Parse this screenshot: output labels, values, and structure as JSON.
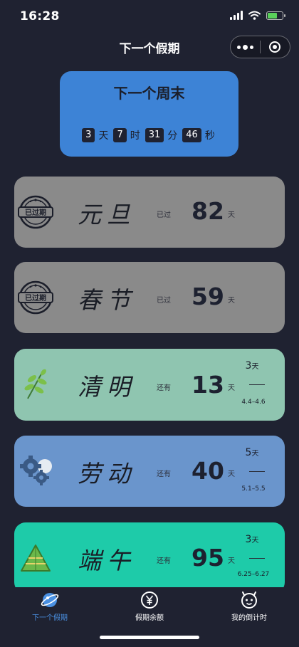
{
  "status_bar": {
    "time": "16:28",
    "icons": [
      "signal-icon",
      "wifi-icon",
      "battery-charging-icon"
    ]
  },
  "nav": {
    "title": "下一个假期",
    "icons": [
      "more-dots-icon",
      "close-target-icon"
    ]
  },
  "weekend": {
    "title": "下一个周末",
    "countdown": [
      {
        "value": "3",
        "unit": "天"
      },
      {
        "value": "7",
        "unit": "时"
      },
      {
        "value": "31",
        "unit": "分"
      },
      {
        "value": "46",
        "unit": "秒"
      }
    ]
  },
  "holidays": [
    {
      "name": "元旦",
      "status": "已过",
      "days": "82",
      "unit": "天",
      "icon": "expired-stamp-icon",
      "color": "#8a8a8a"
    },
    {
      "name": "春节",
      "status": "已过",
      "days": "59",
      "unit": "天",
      "icon": "expired-stamp-icon",
      "color": "#8a8a8a"
    },
    {
      "name": "清明",
      "status": "还有",
      "days": "13",
      "unit": "天",
      "length": "3",
      "length_unit": "天",
      "range": "4.4–4.6",
      "icon": "leaf-sprig-icon",
      "color": "#8fc5b0"
    },
    {
      "name": "劳动",
      "status": "还有",
      "days": "40",
      "unit": "天",
      "length": "5",
      "length_unit": "天",
      "range": "5.1–5.5",
      "icon": "gears-icon",
      "color": "#6a95cc"
    },
    {
      "name": "端午",
      "status": "还有",
      "days": "95",
      "unit": "天",
      "length": "3",
      "length_unit": "天",
      "range": "6.25–6.27",
      "icon": "zongzi-icon",
      "color": "#1ecba9"
    }
  ],
  "tabs": [
    {
      "label": "下一个假期",
      "icon": "planet-icon",
      "active": true
    },
    {
      "label": "假期余额",
      "icon": "yen-coin-icon",
      "active": false
    },
    {
      "label": "我的倒计时",
      "icon": "smiley-face-icon",
      "active": false
    }
  ]
}
